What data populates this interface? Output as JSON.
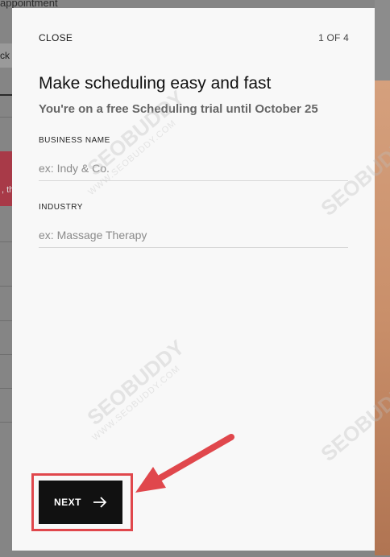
{
  "background": {
    "title_fragment": "appointment",
    "button_fragment": "ck",
    "alert_fragment": ", th"
  },
  "modal": {
    "close_label": "CLOSE",
    "step_indicator": "1 OF 4",
    "title": "Make scheduling easy and fast",
    "subtitle": "You're on a free Scheduling trial until October 25",
    "fields": {
      "business_name": {
        "label": "BUSINESS NAME",
        "placeholder": "ex: Indy & Co."
      },
      "industry": {
        "label": "INDUSTRY",
        "placeholder": "ex: Massage Therapy"
      }
    },
    "next_label": "NEXT",
    "next_icon": "arrow-right-icon"
  },
  "annotation": {
    "highlight_color": "#e0474c",
    "arrow_icon": "pointer-arrow-icon"
  },
  "watermark": {
    "brand": "SEOBUDDY",
    "domain": "WWW.SEOBUDDY.COM"
  }
}
